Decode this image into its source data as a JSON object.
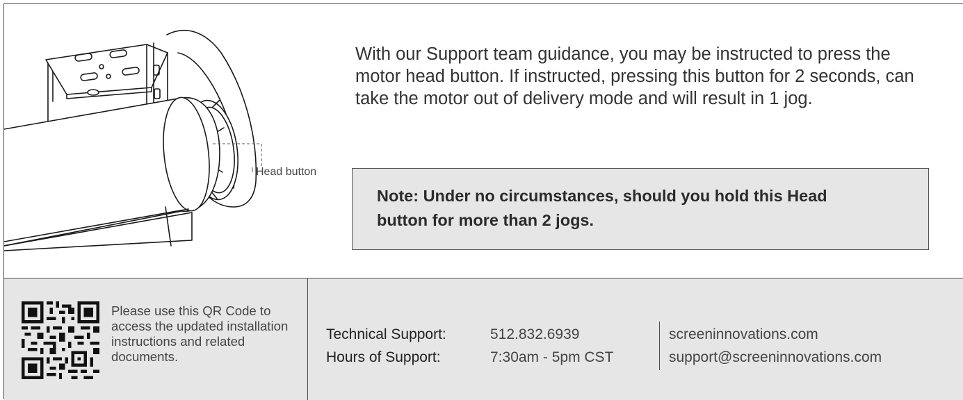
{
  "instructions": {
    "body": "With our Support team guidance, you may be instructed to press the motor head button. If instructed, pressing this button for 2 seconds, can take the motor out of delivery mode and will result in 1 jog.",
    "note": "Note: Under no circumstances, should you hold this Head button for more than 2 jogs.",
    "callout_label": "Head button"
  },
  "footer": {
    "qr_text": "Please use this QR Code to access the updated installation instructions and related documents.",
    "technical_support_label": "Technical Support:",
    "technical_support_value": "512.832.6939",
    "hours_label": "Hours of Support:",
    "hours_value": "7:30am - 5pm CST",
    "website": "screeninnovations.com",
    "email": "support@screeninnovations.com"
  },
  "colors": {
    "border": "#4a4a4a",
    "note_background": "#e6e6e6",
    "footer_background": "#e6e6e6",
    "text": "#333333"
  }
}
